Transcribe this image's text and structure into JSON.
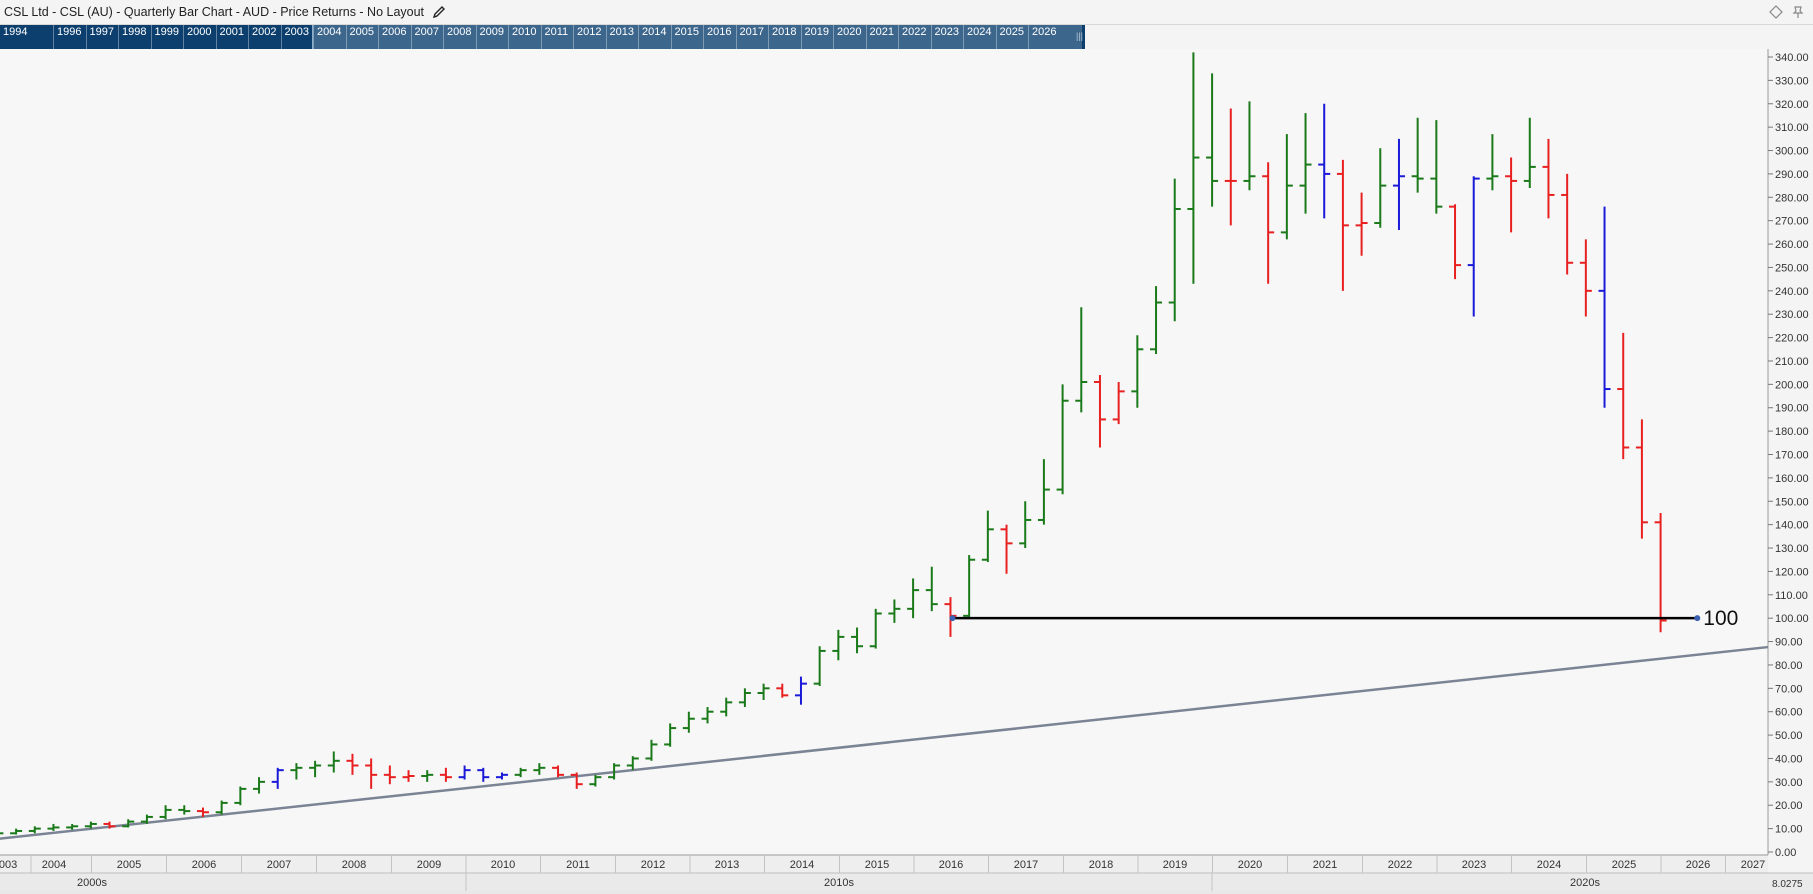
{
  "window": {
    "title": "CSL Ltd - CSL (AU) - Quarterly Bar Chart - AUD - Price Returns - No Layout",
    "icons": [
      "pencil-icon",
      "diamond-icon",
      "pin-icon"
    ]
  },
  "navigator": {
    "years": [
      "1994",
      "1996",
      "1997",
      "1998",
      "1999",
      "2000",
      "2001",
      "2002",
      "2003",
      "2004",
      "2005",
      "2006",
      "2007",
      "2008",
      "2009",
      "2010",
      "2011",
      "2012",
      "2013",
      "2014",
      "2015",
      "2016",
      "2017",
      "2018",
      "2019",
      "2020",
      "2021",
      "2022",
      "2023",
      "2024",
      "2025",
      "2026"
    ]
  },
  "colors": {
    "up": "#1a7a1a",
    "down": "#e82020",
    "neutral": "#1a1ad8",
    "trendline": "#7a8494",
    "hline": "#000000",
    "navbar": "#0d3f6e"
  },
  "chart_data": {
    "type": "ohlc",
    "periodicity": "quarterly",
    "y_axis": {
      "position": "right",
      "ylim": [
        0,
        345
      ],
      "ticks": [
        "0.00",
        "10.00",
        "20.00",
        "30.00",
        "40.00",
        "50.00",
        "60.00",
        "70.00",
        "80.00",
        "90.00",
        "100.00",
        "110.00",
        "120.00",
        "130.00",
        "140.00",
        "150.00",
        "160.00",
        "170.00",
        "180.00",
        "190.00",
        "200.00",
        "210.00",
        "220.00",
        "230.00",
        "240.00",
        "250.00",
        "260.00",
        "270.00",
        "280.00",
        "290.00",
        "300.00",
        "310.00",
        "320.00",
        "330.00",
        "340.00"
      ]
    },
    "x_axis": {
      "year_labels": [
        "003",
        "2004",
        "2005",
        "2006",
        "2007",
        "2008",
        "2009",
        "2010",
        "2011",
        "2012",
        "2013",
        "2014",
        "2015",
        "2016",
        "2017",
        "2018",
        "2019",
        "2020",
        "2021",
        "2022",
        "2023",
        "2024",
        "2025",
        "2026",
        "2027"
      ],
      "decade_labels": [
        "2000s",
        "2010s",
        "2020s"
      ]
    },
    "corner_label": "8.0275",
    "bars": [
      {
        "q": "2003Q1",
        "o": 4.5,
        "h": 6,
        "l": 4,
        "c": 5.5,
        "col": "up"
      },
      {
        "q": "2003Q2",
        "o": 5.5,
        "h": 7,
        "l": 5,
        "c": 6.5,
        "col": "up"
      },
      {
        "q": "2003Q3",
        "o": 6.5,
        "h": 8,
        "l": 6,
        "c": 7.5,
        "col": "up"
      },
      {
        "q": "2003Q4",
        "o": 7.5,
        "h": 9,
        "l": 7,
        "c": 8,
        "col": "up"
      },
      {
        "q": "2004Q1",
        "o": 8,
        "h": 10,
        "l": 7.5,
        "c": 9,
        "col": "up"
      },
      {
        "q": "2004Q2",
        "o": 9,
        "h": 11,
        "l": 8,
        "c": 10,
        "col": "up"
      },
      {
        "q": "2004Q3",
        "o": 10,
        "h": 12,
        "l": 9,
        "c": 10.5,
        "col": "up"
      },
      {
        "q": "2004Q4",
        "o": 10.5,
        "h": 12,
        "l": 9.5,
        "c": 11,
        "col": "up"
      },
      {
        "q": "2005Q1",
        "o": 11,
        "h": 13,
        "l": 10,
        "c": 12,
        "col": "up"
      },
      {
        "q": "2005Q2",
        "o": 12,
        "h": 13,
        "l": 10,
        "c": 11,
        "col": "down"
      },
      {
        "q": "2005Q3",
        "o": 11,
        "h": 14,
        "l": 10.5,
        "c": 13,
        "col": "up"
      },
      {
        "q": "2005Q4",
        "o": 13,
        "h": 16,
        "l": 12,
        "c": 15,
        "col": "up"
      },
      {
        "q": "2006Q1",
        "o": 15,
        "h": 20,
        "l": 14,
        "c": 18,
        "col": "up"
      },
      {
        "q": "2006Q2",
        "o": 18,
        "h": 20,
        "l": 16,
        "c": 17.5,
        "col": "up"
      },
      {
        "q": "2006Q3",
        "o": 17.5,
        "h": 19,
        "l": 15,
        "c": 17,
        "col": "down"
      },
      {
        "q": "2006Q4",
        "o": 17,
        "h": 22,
        "l": 16,
        "c": 21,
        "col": "up"
      },
      {
        "q": "2007Q1",
        "o": 21,
        "h": 28,
        "l": 20,
        "c": 27,
        "col": "up"
      },
      {
        "q": "2007Q2",
        "o": 27,
        "h": 32,
        "l": 25,
        "c": 30,
        "col": "up"
      },
      {
        "q": "2007Q3",
        "o": 30,
        "h": 36,
        "l": 27,
        "c": 35,
        "col": "neutral"
      },
      {
        "q": "2007Q4",
        "o": 35,
        "h": 38,
        "l": 31,
        "c": 36,
        "col": "up"
      },
      {
        "q": "2008Q1",
        "o": 36,
        "h": 39,
        "l": 32,
        "c": 37,
        "col": "up"
      },
      {
        "q": "2008Q2",
        "o": 37,
        "h": 43,
        "l": 34,
        "c": 39,
        "col": "up"
      },
      {
        "q": "2008Q3",
        "o": 39,
        "h": 42,
        "l": 33,
        "c": 37,
        "col": "down"
      },
      {
        "q": "2008Q4",
        "o": 37,
        "h": 40,
        "l": 27,
        "c": 33,
        "col": "down"
      },
      {
        "q": "2009Q1",
        "o": 33,
        "h": 37,
        "l": 29,
        "c": 32,
        "col": "down"
      },
      {
        "q": "2009Q2",
        "o": 32,
        "h": 35,
        "l": 30,
        "c": 32.5,
        "col": "down"
      },
      {
        "q": "2009Q3",
        "o": 32.5,
        "h": 35,
        "l": 30,
        "c": 33,
        "col": "up"
      },
      {
        "q": "2009Q4",
        "o": 33,
        "h": 36,
        "l": 30,
        "c": 32,
        "col": "down"
      },
      {
        "q": "2010Q1",
        "o": 32,
        "h": 37,
        "l": 31,
        "c": 35,
        "col": "neutral"
      },
      {
        "q": "2010Q2",
        "o": 35,
        "h": 36,
        "l": 30,
        "c": 32,
        "col": "neutral"
      },
      {
        "q": "2010Q3",
        "o": 32,
        "h": 34,
        "l": 31,
        "c": 33,
        "col": "neutral"
      },
      {
        "q": "2010Q4",
        "o": 33,
        "h": 36,
        "l": 32,
        "c": 35,
        "col": "up"
      },
      {
        "q": "2011Q1",
        "o": 35,
        "h": 38,
        "l": 33,
        "c": 36,
        "col": "up"
      },
      {
        "q": "2011Q2",
        "o": 36,
        "h": 37,
        "l": 32,
        "c": 33,
        "col": "down"
      },
      {
        "q": "2011Q3",
        "o": 33,
        "h": 34,
        "l": 27,
        "c": 29,
        "col": "down"
      },
      {
        "q": "2011Q4",
        "o": 29,
        "h": 33,
        "l": 28,
        "c": 32,
        "col": "up"
      },
      {
        "q": "2012Q1",
        "o": 32,
        "h": 38,
        "l": 31,
        "c": 37,
        "col": "up"
      },
      {
        "q": "2012Q2",
        "o": 37,
        "h": 41,
        "l": 35,
        "c": 40,
        "col": "up"
      },
      {
        "q": "2012Q3",
        "o": 40,
        "h": 48,
        "l": 39,
        "c": 46,
        "col": "up"
      },
      {
        "q": "2012Q4",
        "o": 46,
        "h": 55,
        "l": 45,
        "c": 53,
        "col": "up"
      },
      {
        "q": "2013Q1",
        "o": 53,
        "h": 60,
        "l": 51,
        "c": 57,
        "col": "up"
      },
      {
        "q": "2013Q2",
        "o": 57,
        "h": 62,
        "l": 55,
        "c": 60,
        "col": "up"
      },
      {
        "q": "2013Q3",
        "o": 60,
        "h": 66,
        "l": 58,
        "c": 64,
        "col": "up"
      },
      {
        "q": "2013Q4",
        "o": 64,
        "h": 70,
        "l": 62,
        "c": 68,
        "col": "up"
      },
      {
        "q": "2014Q1",
        "o": 68,
        "h": 72,
        "l": 65,
        "c": 70,
        "col": "up"
      },
      {
        "q": "2014Q2",
        "o": 70,
        "h": 72,
        "l": 66,
        "c": 67,
        "col": "down"
      },
      {
        "q": "2014Q3",
        "o": 67,
        "h": 75,
        "l": 63,
        "c": 72,
        "col": "neutral"
      },
      {
        "q": "2014Q4",
        "o": 72,
        "h": 88,
        "l": 71,
        "c": 86,
        "col": "up"
      },
      {
        "q": "2015Q1",
        "o": 86,
        "h": 95,
        "l": 82,
        "c": 92,
        "col": "up"
      },
      {
        "q": "2015Q2",
        "o": 92,
        "h": 96,
        "l": 85,
        "c": 88,
        "col": "up"
      },
      {
        "q": "2015Q3",
        "o": 88,
        "h": 104,
        "l": 87,
        "c": 102,
        "col": "up"
      },
      {
        "q": "2015Q4",
        "o": 102,
        "h": 108,
        "l": 98,
        "c": 104,
        "col": "up"
      },
      {
        "q": "2016Q1",
        "o": 104,
        "h": 117,
        "l": 100,
        "c": 112,
        "col": "up"
      },
      {
        "q": "2016Q2",
        "o": 112,
        "h": 122,
        "l": 103,
        "c": 106,
        "col": "up"
      },
      {
        "q": "2016Q3",
        "o": 106,
        "h": 109,
        "l": 92,
        "c": 101,
        "col": "down"
      },
      {
        "q": "2016Q4",
        "o": 101,
        "h": 127,
        "l": 100,
        "c": 125,
        "col": "up"
      },
      {
        "q": "2017Q1",
        "o": 125,
        "h": 146,
        "l": 124,
        "c": 138,
        "col": "up"
      },
      {
        "q": "2017Q2",
        "o": 138,
        "h": 140,
        "l": 119,
        "c": 132,
        "col": "down"
      },
      {
        "q": "2017Q3",
        "o": 132,
        "h": 150,
        "l": 130,
        "c": 142,
        "col": "up"
      },
      {
        "q": "2017Q4",
        "o": 142,
        "h": 168,
        "l": 140,
        "c": 155,
        "col": "up"
      },
      {
        "q": "2018Q1",
        "o": 155,
        "h": 200,
        "l": 153,
        "c": 193,
        "col": "up"
      },
      {
        "q": "2018Q2",
        "o": 193,
        "h": 233,
        "l": 188,
        "c": 201,
        "col": "up"
      },
      {
        "q": "2018Q3",
        "o": 201,
        "h": 204,
        "l": 173,
        "c": 185,
        "col": "down"
      },
      {
        "q": "2018Q4",
        "o": 185,
        "h": 201,
        "l": 183,
        "c": 197,
        "col": "down"
      },
      {
        "q": "2019Q1",
        "o": 197,
        "h": 221,
        "l": 190,
        "c": 215,
        "col": "up"
      },
      {
        "q": "2019Q2",
        "o": 215,
        "h": 242,
        "l": 213,
        "c": 235,
        "col": "up"
      },
      {
        "q": "2019Q3",
        "o": 235,
        "h": 288,
        "l": 227,
        "c": 275,
        "col": "up"
      },
      {
        "q": "2019Q4",
        "o": 275,
        "h": 342,
        "l": 243,
        "c": 297,
        "col": "up"
      },
      {
        "q": "2020Q1",
        "o": 297,
        "h": 333,
        "l": 276,
        "c": 287,
        "col": "up"
      },
      {
        "q": "2020Q2",
        "o": 287,
        "h": 318,
        "l": 268,
        "c": 287,
        "col": "down"
      },
      {
        "q": "2020Q3",
        "o": 287,
        "h": 321,
        "l": 283,
        "c": 289,
        "col": "up"
      },
      {
        "q": "2020Q4",
        "o": 289,
        "h": 295,
        "l": 243,
        "c": 265,
        "col": "down"
      },
      {
        "q": "2021Q1",
        "o": 265,
        "h": 307,
        "l": 262,
        "c": 285,
        "col": "up"
      },
      {
        "q": "2021Q2",
        "o": 285,
        "h": 316,
        "l": 273,
        "c": 294,
        "col": "up"
      },
      {
        "q": "2021Q3",
        "o": 294,
        "h": 320,
        "l": 271,
        "c": 290,
        "col": "neutral"
      },
      {
        "q": "2021Q4",
        "o": 290,
        "h": 296,
        "l": 240,
        "c": 268,
        "col": "down"
      },
      {
        "q": "2022Q1",
        "o": 268,
        "h": 282,
        "l": 255,
        "c": 269,
        "col": "down"
      },
      {
        "q": "2022Q2",
        "o": 269,
        "h": 301,
        "l": 267,
        "c": 285,
        "col": "up"
      },
      {
        "q": "2022Q3",
        "o": 285,
        "h": 305,
        "l": 266,
        "c": 289,
        "col": "neutral"
      },
      {
        "q": "2022Q4",
        "o": 289,
        "h": 314,
        "l": 282,
        "c": 288,
        "col": "up"
      },
      {
        "q": "2023Q1",
        "o": 288,
        "h": 313,
        "l": 273,
        "c": 276,
        "col": "up"
      },
      {
        "q": "2023Q2",
        "o": 276,
        "h": 277,
        "l": 245,
        "c": 251,
        "col": "down"
      },
      {
        "q": "2023Q3",
        "o": 251,
        "h": 289,
        "l": 229,
        "c": 288,
        "col": "neutral"
      },
      {
        "q": "2023Q4",
        "o": 288,
        "h": 307,
        "l": 283,
        "c": 289,
        "col": "up"
      },
      {
        "q": "2024Q1",
        "o": 289,
        "h": 297,
        "l": 265,
        "c": 287,
        "col": "down"
      },
      {
        "q": "2024Q2",
        "o": 287,
        "h": 314,
        "l": 284,
        "c": 293,
        "col": "up"
      },
      {
        "q": "2024Q3",
        "o": 293,
        "h": 305,
        "l": 271,
        "c": 281,
        "col": "down"
      },
      {
        "q": "2024Q4",
        "o": 281,
        "h": 290,
        "l": 247,
        "c": 252,
        "col": "down"
      },
      {
        "q": "2025Q1",
        "o": 252,
        "h": 262,
        "l": 229,
        "c": 240,
        "col": "down"
      },
      {
        "q": "2025Q2",
        "o": 240,
        "h": 276,
        "l": 190,
        "c": 198,
        "col": "neutral"
      },
      {
        "q": "2025Q3",
        "o": 198,
        "h": 222,
        "l": 168,
        "c": 173,
        "col": "down"
      },
      {
        "q": "2025Q4",
        "o": 173,
        "h": 185,
        "l": 134,
        "c": 141,
        "col": "down"
      },
      {
        "q": "2026Q1",
        "o": 141,
        "h": 145,
        "l": 94,
        "c": 99,
        "col": "down"
      }
    ],
    "horizontal_line": {
      "value": 100,
      "from": "2016Q3",
      "to": "2026Q2",
      "label": "100"
    },
    "trendline": {
      "from": {
        "x": "2003Q1",
        "y": 3
      },
      "to": {
        "x": "2027Q2",
        "y": 87
      }
    }
  }
}
